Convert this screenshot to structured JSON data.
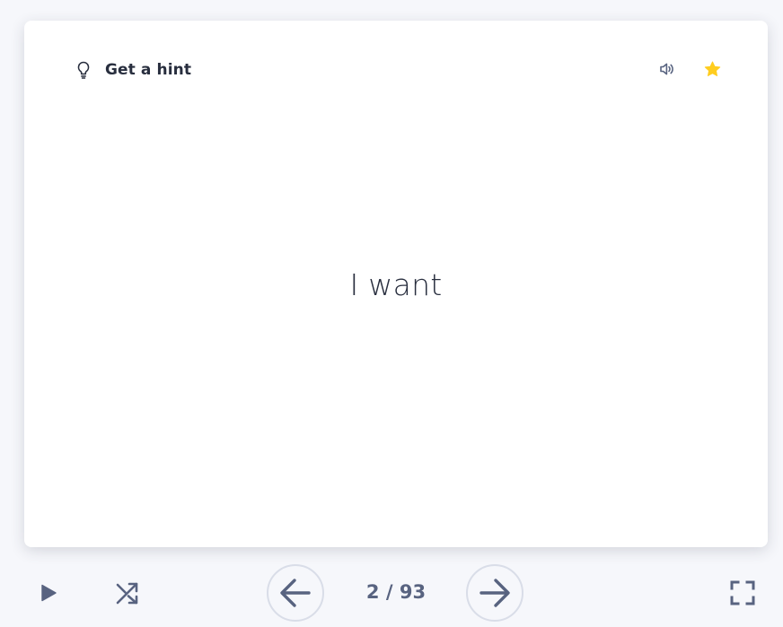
{
  "card": {
    "hint_label": "Get a hint",
    "term": "I want"
  },
  "icons": {
    "hint": "lightbulb-icon",
    "audio": "speaker-icon",
    "star": "star-icon",
    "play": "play-icon",
    "shuffle": "shuffle-icon",
    "prev": "arrow-left-icon",
    "next": "arrow-right-icon",
    "fullscreen": "fullscreen-icon"
  },
  "progress": {
    "current": 2,
    "total": 93,
    "label": "2 / 93"
  },
  "colors": {
    "star_active": "#ffcd1f",
    "icon_gray": "#586380",
    "text_dark": "#282e3e",
    "circle_border": "#d9dde8",
    "page_bg": "#f6f7fb"
  }
}
